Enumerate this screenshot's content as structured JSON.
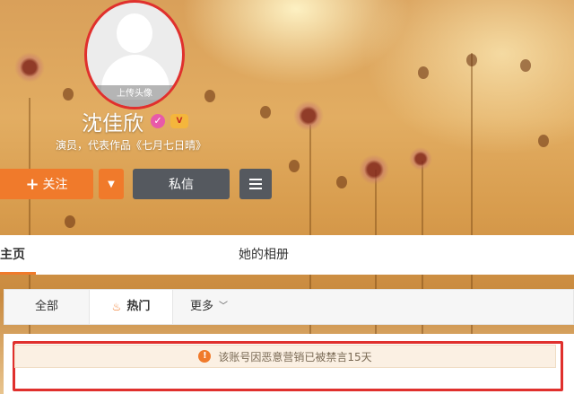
{
  "profile": {
    "avatar_caption": "上传头像",
    "name": "沈佳欣",
    "bio": "演员，代表作品《七月七日晴》",
    "verify_icon": "verified-icon",
    "vip_icon": "vip-icon"
  },
  "actions": {
    "follow_label": "关注",
    "follow_icon": "+",
    "dropdown_icon": "▼",
    "message_label": "私信",
    "menu_icon": "hamburger-menu-icon"
  },
  "profile_tabs": {
    "home": "她的主页",
    "album": "她的相册"
  },
  "feed_filter": {
    "all": "全部",
    "hot": "热门",
    "more": "更多",
    "more_icon": "chevron-down-icon"
  },
  "notice": {
    "text": "该账号因恶意营销已被禁言15天",
    "icon": "!"
  },
  "colors": {
    "accent": "#f07a2b",
    "dark_button": "#55595f",
    "highlight_border": "#e0302d"
  }
}
